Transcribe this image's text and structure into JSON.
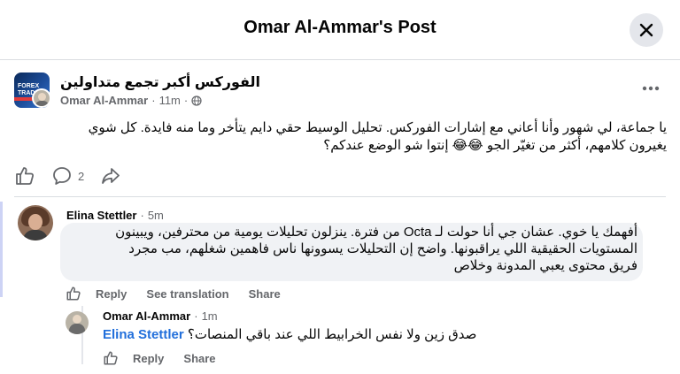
{
  "dialog": {
    "title": "Omar Al-Ammar's Post",
    "close_icon": "close-icon"
  },
  "post": {
    "group_name": "الفوركس أكبر تجمع متداولين",
    "avatar_text": "FOREX TRADERS",
    "author": "Omar Al-Ammar",
    "separator": "·",
    "time": "11m",
    "visibility_icon": "globe-icon",
    "more_icon": "more-horizontal-icon",
    "body_line1": "يا جماعة، لي شهور وأنا أعاني مع إشارات الفوركس. تحليل الوسيط حقي دايم يتأخر وما منه فايدة. كل شوي",
    "body_line2": "يغيرون كلامهم، أكثر من تغيّر الجو 😂😂 إنتوا شو الوضع عندكم؟",
    "comment_count": "2",
    "actions": [
      "like-icon",
      "comment-icon",
      "share-icon"
    ]
  },
  "comments": [
    {
      "author": "Elina Stettler",
      "separator": "·",
      "time": "5m",
      "text_line1": "أفهمك يا خوي. عشان جي أنا حولت لـ Octa من فترة. ينزلون تحليلات يومية من محترفين، ويبينون",
      "text_line2": "المستويات الحقيقية اللي يراقبونها. واضح إن التحليلات يسوونها ناس فاهمين شغلهم، مب مجرد",
      "text_line3": "فريق محتوى يعبي المدونة وخلاص",
      "reply_label": "Reply",
      "translate_label": "See translation",
      "share_label": "Share"
    },
    {
      "author": "Omar Al-Ammar",
      "separator": "·",
      "time": "1m",
      "mention": "Elina Stettler",
      "text": "صدق زين ولا نفس الخرابيط اللي عند باقي المنصات؟",
      "reply_label": "Reply",
      "share_label": "Share"
    }
  ],
  "colors": {
    "text": "#050505",
    "secondary": "#65676b",
    "mention": "#216fdb",
    "bubble": "#f0f2f5",
    "divider": "#dadde1"
  }
}
